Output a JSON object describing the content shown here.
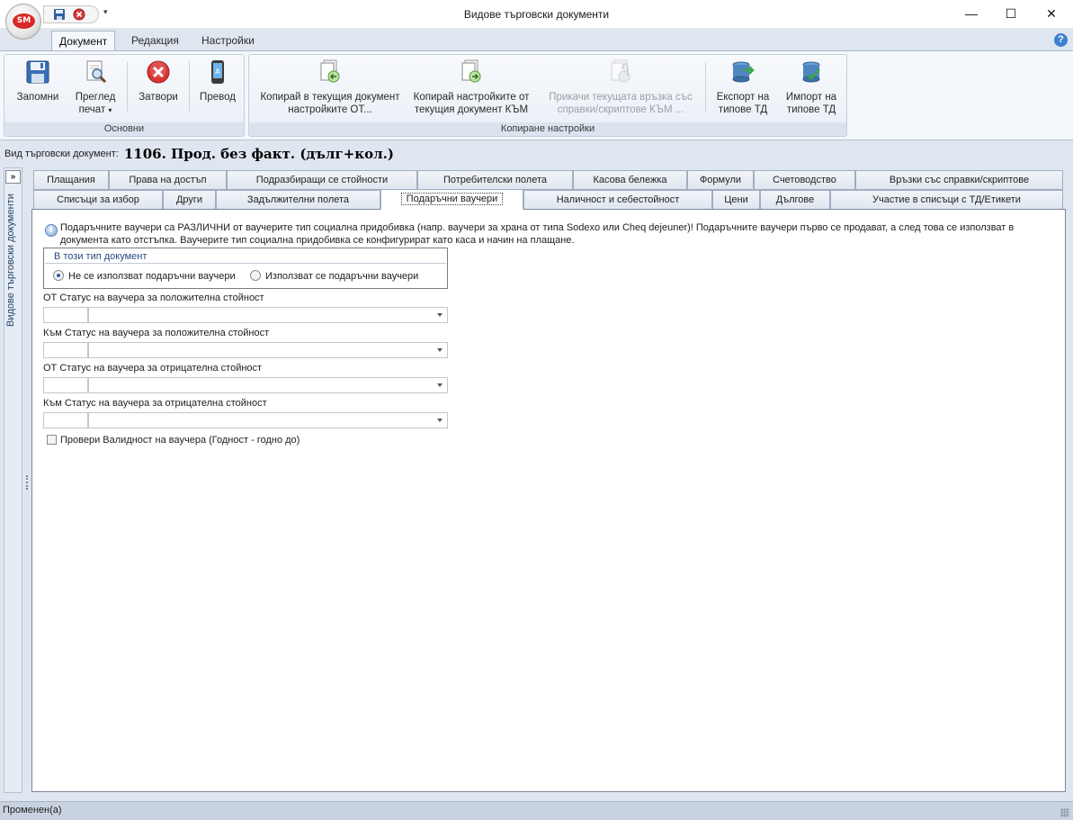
{
  "window": {
    "title": "Видове търговски документи",
    "app_logo_text": "SM",
    "minimize_glyph": "—",
    "maximize_glyph": "☐",
    "close_glyph": "✕"
  },
  "ribbon_tabs": [
    {
      "label": "Документ",
      "active": true
    },
    {
      "label": "Редакция",
      "active": false
    },
    {
      "label": "Настройки",
      "active": false
    }
  ],
  "ribbon": {
    "groups": [
      {
        "label": "Основни",
        "buttons": [
          {
            "label": "Запомни",
            "icon": "save-icon"
          },
          {
            "label": "Преглед печат",
            "icon": "print-preview-icon"
          },
          {
            "label": "Затвори",
            "icon": "close-icon"
          },
          {
            "label": "Превод",
            "icon": "translate-icon"
          }
        ]
      },
      {
        "label": "Копиране настройки",
        "buttons": [
          {
            "label": "Копирай в текущия документ настройките ОТ...",
            "icon": "copy-from-icon"
          },
          {
            "label": "Копирай настройките от текущия документ КЪМ",
            "icon": "copy-to-icon"
          },
          {
            "label": "Прикачи текущата връзка със справки/скриптове КЪМ ...",
            "icon": "attach-link-icon",
            "disabled": true
          },
          {
            "label": "Експорт на типове ТД",
            "icon": "export-icon"
          },
          {
            "label": "Импорт на типове ТД",
            "icon": "import-icon"
          }
        ]
      }
    ]
  },
  "doctype": {
    "label": "Вид търговски документ:",
    "value": "1106. Прод. без факт. (дълг+кол.)"
  },
  "side_panel": {
    "toggle": "»",
    "label": "Видове търговски документи"
  },
  "tabs_row1": [
    "Плащания",
    "Права на достъп",
    "Подразбиращи се стойности",
    "Потребителски полета",
    "Касова бележка",
    "Формули",
    "Счетоводство",
    "Връзки със справки/скриптове"
  ],
  "tabs_row2": [
    "Списъци за избор",
    "Други",
    "Задължителни полета",
    "Подаръчни ваучери",
    "Наличност и себестойност",
    "Цени",
    "Дългове",
    "Участие в списъци с ТД/Етикети"
  ],
  "active_tab": "Подаръчни ваучери",
  "content": {
    "info_text": "Подаръчните ваучери са РАЗЛИЧНИ от ваучерите тип социална придобивка (напр. ваучери за храна от типа Sodexo или Cheq dejeuner)! Подаръчните ваучери първо се продават, а след това се използват в документа като отстъпка. Ваучерите тип социална придобивка се конфигурират като каса и начин на плащане.",
    "radio_group": {
      "title": "В този тип документ",
      "options": [
        {
          "label": "Не се използват подаръчни ваучери",
          "checked": true
        },
        {
          "label": "Използват се подаръчни ваучери",
          "checked": false
        }
      ]
    },
    "fields": [
      {
        "label": "ОТ Статус на ваучера за положителна стойност",
        "code": "",
        "value": ""
      },
      {
        "label": "Към Статус на ваучера за положителна стойност",
        "code": "",
        "value": ""
      },
      {
        "label": "ОТ Статус на ваучера за отрицателна стойност",
        "code": "",
        "value": ""
      },
      {
        "label": "Към Статус на ваучера за отрицателна стойност",
        "code": "",
        "value": ""
      }
    ],
    "checkbox": {
      "label": "Провери Валидност на ваучера (Годност - годно до)",
      "checked": false
    }
  },
  "status": {
    "text": "Променен(а)"
  }
}
